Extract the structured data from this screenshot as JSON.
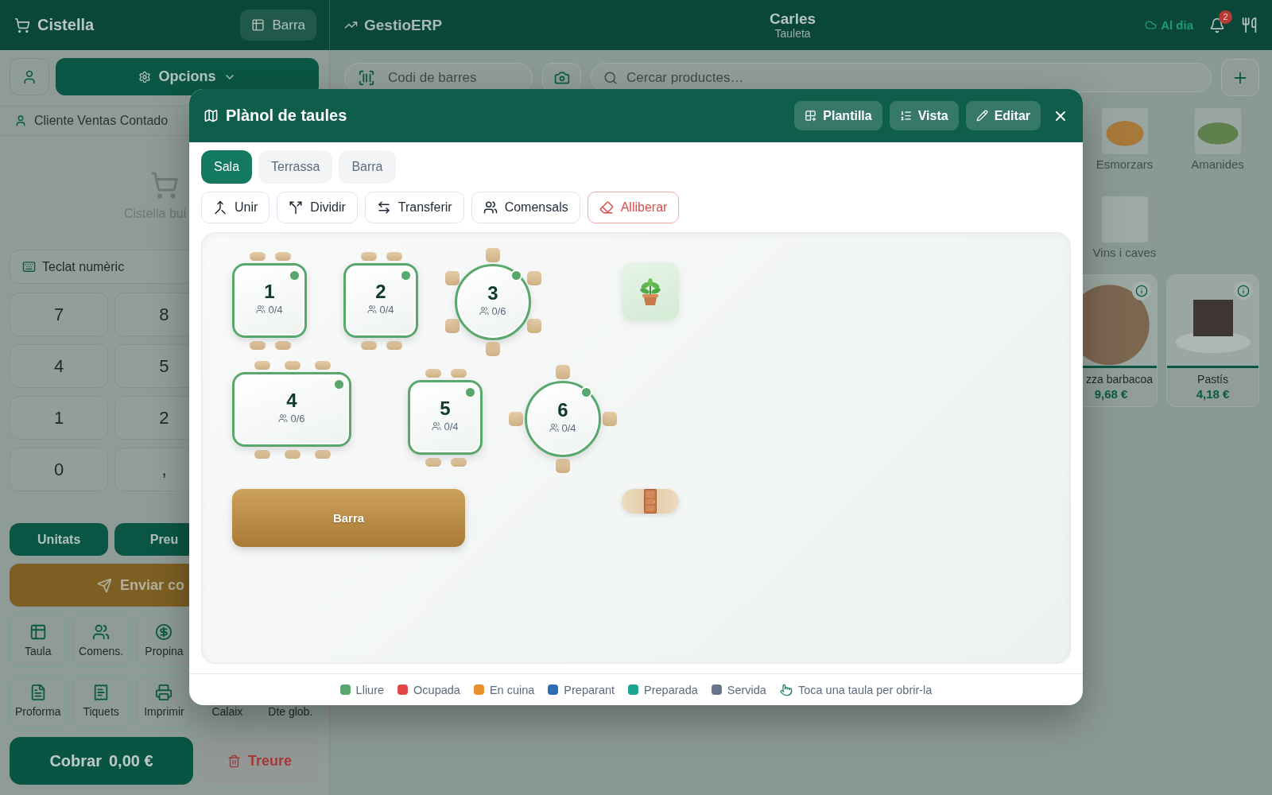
{
  "cart_panel": {
    "title": "Cistella",
    "table_button": "Barra",
    "options_button": "Opcions",
    "customer": "Cliente Ventas Contado",
    "empty_text": "Cistella bui",
    "keypad_field": "Teclat numèric",
    "keypad_rows": [
      [
        "7",
        "8"
      ],
      [
        "4",
        "5"
      ],
      [
        "1",
        "2"
      ],
      [
        "0",
        ","
      ]
    ],
    "mode_buttons": [
      "Unitats",
      "Preu"
    ],
    "send_button": "Enviar co",
    "action_rows": [
      [
        "Taula",
        "Comens.",
        "Propina"
      ],
      [
        "Proforma",
        "Tiquets",
        "Imprimir",
        "Calaix",
        "Dte glob."
      ]
    ],
    "charge_button": {
      "label": "Cobrar",
      "amount": "0,00 €"
    },
    "remove_button": "Treure"
  },
  "app_header": {
    "brand": "GestioERP",
    "user": "Carles",
    "device": "Tauleta",
    "sync_status": "Al dia",
    "notification_count": "2"
  },
  "toolbar": {
    "barcode_placeholder": "Codi de barres",
    "search_placeholder": "Cercar productes…"
  },
  "categories": [
    {
      "name": "Esmorzars"
    },
    {
      "name": "Amanides"
    },
    {
      "name": "Vins i caves"
    }
  ],
  "products": [
    {
      "name": "zza barbacoa",
      "price": "9,68 €"
    },
    {
      "name": "Pastís",
      "price": "4,18 €"
    }
  ],
  "floor_plan": {
    "title": "Plànol de taules",
    "header_buttons": [
      "Plantilla",
      "Vista",
      "Editar"
    ],
    "tabs": [
      {
        "label": "Sala",
        "selected": true
      },
      {
        "label": "Terrassa",
        "selected": false
      },
      {
        "label": "Barra",
        "selected": false
      }
    ],
    "actions": [
      {
        "label": "Unir",
        "kind": "normal"
      },
      {
        "label": "Dividir",
        "kind": "normal"
      },
      {
        "label": "Transferir",
        "kind": "normal"
      },
      {
        "label": "Comensals",
        "kind": "normal"
      },
      {
        "label": "Alliberar",
        "kind": "danger"
      }
    ],
    "tables": [
      {
        "number": "1",
        "seats": "0/4",
        "kind": "square",
        "color": "#58a76c"
      },
      {
        "number": "2",
        "seats": "0/4",
        "kind": "square",
        "color": "#58a76c"
      },
      {
        "number": "3",
        "seats": "0/6",
        "kind": "round6",
        "color": "#58a76c"
      },
      {
        "number": "4",
        "seats": "0/6",
        "kind": "long",
        "color": "#58a76c"
      },
      {
        "number": "5",
        "seats": "0/4",
        "kind": "square",
        "color": "#58a76c"
      },
      {
        "number": "6",
        "seats": "0/4",
        "kind": "round4",
        "color": "#58a76c"
      }
    ],
    "fixtures": [
      {
        "kind": "plant"
      },
      {
        "kind": "counter",
        "label": "Barra"
      },
      {
        "kind": "door"
      }
    ],
    "legend": [
      {
        "label": "Lliure",
        "color": "#58a76c"
      },
      {
        "label": "Ocupada",
        "color": "#e04848"
      },
      {
        "label": "En cuina",
        "color": "#e8912c"
      },
      {
        "label": "Preparant",
        "color": "#2e6db4"
      },
      {
        "label": "Preparada",
        "color": "#1aa58e"
      },
      {
        "label": "Servida",
        "color": "#687489"
      }
    ],
    "hint": "Toca una taula per obrir-la"
  }
}
